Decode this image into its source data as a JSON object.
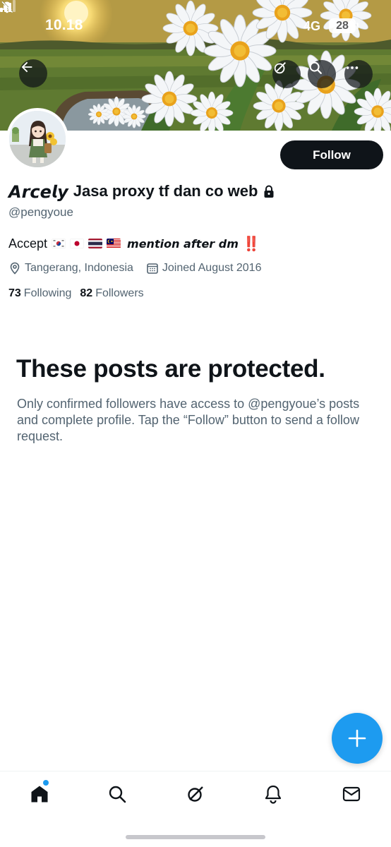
{
  "status_bar": {
    "time": "10.18",
    "network": "4G",
    "battery": "28"
  },
  "banner": {
    "icons": [
      "back-arrow-icon",
      "grok-icon",
      "search-icon",
      "more-icon"
    ]
  },
  "profile": {
    "name_stylized": "𝘼𝙧𝙘𝙚𝙡𝙮",
    "name_text": "Jasa proxy tf dan co web",
    "handle": "@pengyoue",
    "protected": true,
    "follow_label": "Follow",
    "bio": {
      "prefix": "Accept",
      "flags": [
        "south-korea-flag",
        "japan-flag",
        "thailand-flag",
        "malaysia-flag"
      ],
      "stylized_text": "𝙢𝙚𝙣𝙩𝙞𝙤𝙣 𝙖𝙛𝙩𝙚𝙧 𝙙𝙢",
      "mark": "‼️"
    },
    "location": "Tangerang, Indonesia",
    "joined": "Joined August 2016",
    "following_count": "73",
    "following_label": "Following",
    "followers_count": "82",
    "followers_label": "Followers"
  },
  "protected_notice": {
    "title": "These posts are protected.",
    "body": "Only confirmed followers have access to @pengyoue’s posts and complete profile. Tap the “Follow” button to send a follow request."
  },
  "bottom_nav": {
    "items": [
      "home-icon",
      "search-icon",
      "grok-icon",
      "notifications-icon",
      "messages-icon"
    ],
    "active": "home"
  },
  "colors": {
    "accent": "#1d9bf0",
    "text_primary": "#0f1419",
    "text_secondary": "#536471",
    "follow_button": "#0f1419"
  }
}
